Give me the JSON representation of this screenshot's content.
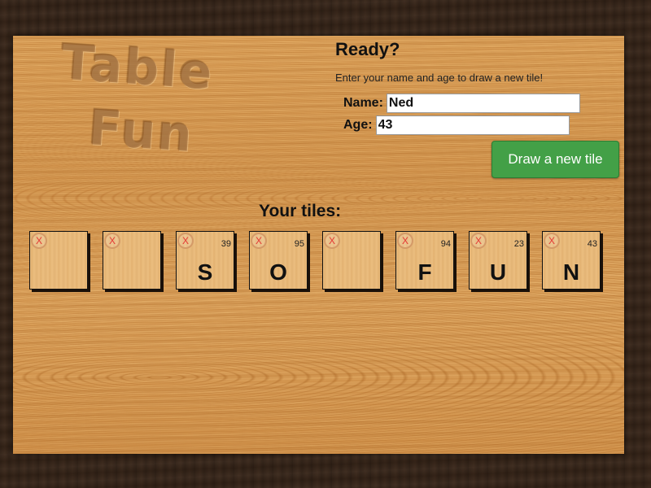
{
  "logo": {
    "line1": "Table",
    "line2": "Fun"
  },
  "form": {
    "heading": "Ready?",
    "instructions": "Enter your name and age to draw a new tile!",
    "name_label": "Name:",
    "name_value": "Ned",
    "age_label": "Age:",
    "age_value": "43",
    "draw_button_label": "Draw a new tile"
  },
  "tiles_heading": "Your tiles:",
  "tiles": [
    {
      "letter": "",
      "score": "",
      "remove_label": "X"
    },
    {
      "letter": "",
      "score": "",
      "remove_label": "X"
    },
    {
      "letter": "S",
      "score": "39",
      "remove_label": "X"
    },
    {
      "letter": "O",
      "score": "95",
      "remove_label": "X"
    },
    {
      "letter": "",
      "score": "",
      "remove_label": "X"
    },
    {
      "letter": "F",
      "score": "94",
      "remove_label": "X"
    },
    {
      "letter": "U",
      "score": "23",
      "remove_label": "X"
    },
    {
      "letter": "N",
      "score": "43",
      "remove_label": "X"
    }
  ],
  "colors": {
    "button": "#43a047",
    "remove_x": "#e53935"
  }
}
